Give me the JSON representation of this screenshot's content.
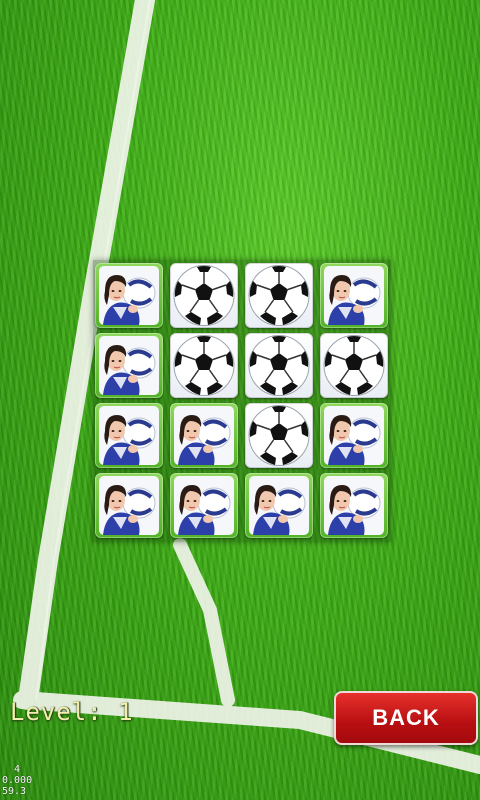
{
  "game": {
    "level_label": "Level: 1",
    "back_label": "BACK",
    "debug_lines": [
      "  4",
      "0.000",
      "59.3"
    ]
  },
  "board": {
    "rows": 4,
    "cols": 4,
    "tiles": [
      [
        "player",
        "ball",
        "ball",
        "player"
      ],
      [
        "player",
        "ball",
        "ball",
        "ball"
      ],
      [
        "player",
        "player",
        "ball",
        "player"
      ],
      [
        "player",
        "player",
        "player",
        "player"
      ]
    ],
    "tile_faces": {
      "player": "player-photo-icon",
      "ball": "soccer-ball-icon"
    }
  },
  "colors": {
    "grass": "#3fae17",
    "back_button": "#d41e1e",
    "level_text": "#f3eeb0"
  }
}
